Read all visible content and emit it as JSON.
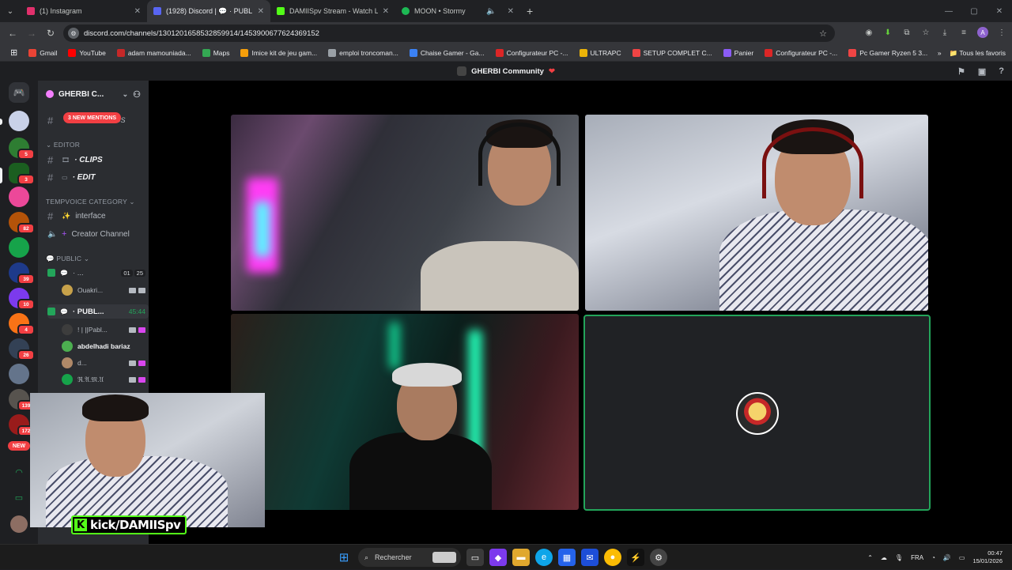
{
  "browser": {
    "tabs": [
      {
        "title": "(1) Instagram",
        "color": "#e1306c"
      },
      {
        "title": "(1928) Discord | 💬 · PUBL",
        "color": "#5865f2"
      },
      {
        "title": "DAMIISpv Stream - Watch Live",
        "color": "#53fc18"
      },
      {
        "title": "MOON • Stormy",
        "color": "#1db954"
      }
    ],
    "url": "discord.com/channels/1301201658532859914/1453900677624369152",
    "bookmarks": [
      {
        "label": "Gmail",
        "color": "#ea4335"
      },
      {
        "label": "YouTube",
        "color": "#ff0000"
      },
      {
        "label": "adam mamouniada...",
        "color": "#c62828"
      },
      {
        "label": "Maps",
        "color": "#34a853"
      },
      {
        "label": "Imice kit de jeu gam...",
        "color": "#f59e0b"
      },
      {
        "label": "emploi troncoman...",
        "color": "#9aa0a6"
      },
      {
        "label": "Chaise Gamer - Ga...",
        "color": "#3b82f6"
      },
      {
        "label": "Configurateur PC -...",
        "color": "#dc2626"
      },
      {
        "label": "ULTRAPC",
        "color": "#eab308"
      },
      {
        "label": "SETUP COMPLET C...",
        "color": "#ef4444"
      },
      {
        "label": "Panier",
        "color": "#8b5cf6"
      },
      {
        "label": "Configurateur PC -...",
        "color": "#dc2626"
      },
      {
        "label": "Pc Gamer Ryzen 5 3...",
        "color": "#ef4444"
      }
    ],
    "all_favorites": "Tous les favoris"
  },
  "discord": {
    "title": "GHERBI Community",
    "title_heart": "❤",
    "server_name": "GHERBI C...",
    "mentions": "3 NEW MENTIONS",
    "hidden_channel": "DS",
    "editor_category": "EDITOR",
    "channels": [
      {
        "name": "· CLIPS",
        "icon": "🎞"
      },
      {
        "name": "· EDIT",
        "icon": "▭"
      }
    ],
    "tempvoice_category": "TEMPVOICE CATEGORY",
    "interface_channel": "interface",
    "interface_emoji": "✨",
    "creator_channel": "Creator Channel",
    "public_category": "PUBLIC",
    "voice_channels": [
      {
        "name": "· ...",
        "counts": [
          "01",
          "25"
        ]
      },
      {
        "name": "· PUBL...",
        "timer": "45:44"
      }
    ],
    "users_first": [
      {
        "name": "Ouakri...",
        "color": "#c7a14a"
      }
    ],
    "users": [
      {
        "name": "! | ||Pabl...",
        "color": "#3d3d3d",
        "live": true
      },
      {
        "name": "abdelhadi bariaz",
        "color": "#4caf50",
        "live": false
      },
      {
        "name": "d...",
        "color": "#b08968",
        "live": true
      },
      {
        "name": "ℜ.𝔄.𝔐.𝔘",
        "color": "#16a34a",
        "live": true
      }
    ],
    "server_badges": [
      "5",
      "3",
      "82",
      "39",
      "10",
      "4",
      "26",
      "139",
      "172"
    ],
    "new_badge": "NEW"
  },
  "overlay": {
    "kick_logo": "K",
    "kick_text": "kick/DAMIISpv"
  },
  "taskbar": {
    "search": "Rechercher",
    "lang": "FRA",
    "time": "00:47",
    "date": "15/01/2026"
  }
}
